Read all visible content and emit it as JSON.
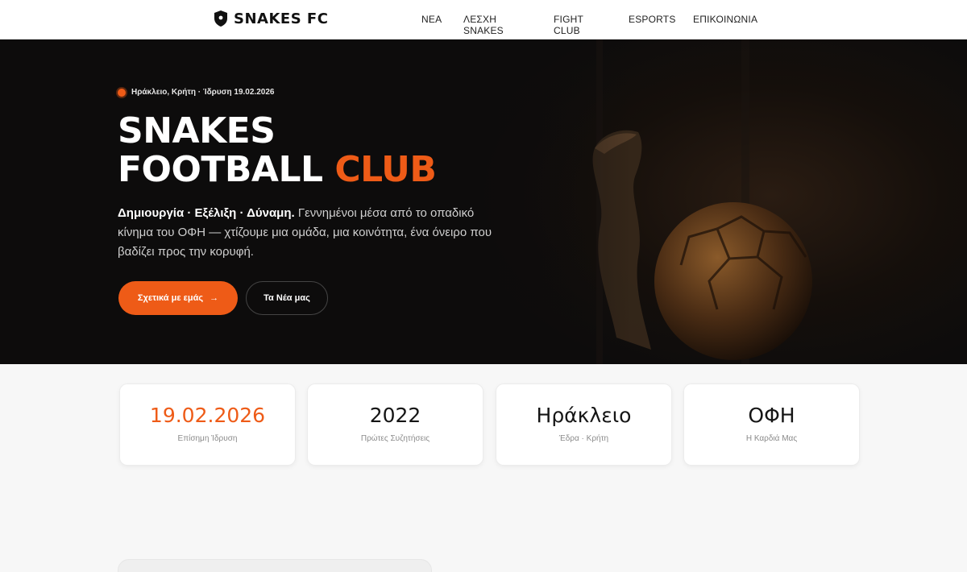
{
  "brand": {
    "name": "SNAKES FC"
  },
  "nav": {
    "items": [
      {
        "label": "ΝΕΑ"
      },
      {
        "label": "ΛΕΣΧΗ SNAKES"
      },
      {
        "label": "FIGHT CLUB"
      },
      {
        "label": "ESPORTS"
      },
      {
        "label": "ΕΠΙΚΟΙΝΩΝΙΑ"
      }
    ]
  },
  "hero": {
    "kicker": "Ηράκλειο, Κρήτη · Ίδρυση 19.02.2026",
    "title_line1": "SNAKES",
    "title_line2_white": "FOOTBALL",
    "title_line2_accent": "CLUB",
    "lead_bold": "Δημιουργία · Εξέλιξη · Δύναμη.",
    "lead_text": " Γεννημένοι μέσα από το οπαδικό κίνημα του ΟΦΗ — χτίζουμε μια ομάδα, μια κοινότητα, ένα όνειρο που βαδίζει προς την κορυφή.",
    "primary_button": "Σχετικά με εμάς",
    "primary_button_icon": "→",
    "secondary_button": "Τα Νέα μας"
  },
  "stats": [
    {
      "value": "19.02.2026",
      "label": "Επίσημη Ίδρυση",
      "accent": true
    },
    {
      "value": "2022",
      "label": "Πρώτες Συζητήσεις",
      "accent": false
    },
    {
      "value": "Ηράκλειο",
      "label": "Έδρα · Κρήτη",
      "accent": false
    },
    {
      "value": "ΟΦΗ",
      "label": "Η Καρδιά Μας",
      "accent": false
    }
  ],
  "colors": {
    "accent": "#ee5b17",
    "hero_bg": "#0d0c0c",
    "page_bg": "#f7f7f7"
  }
}
